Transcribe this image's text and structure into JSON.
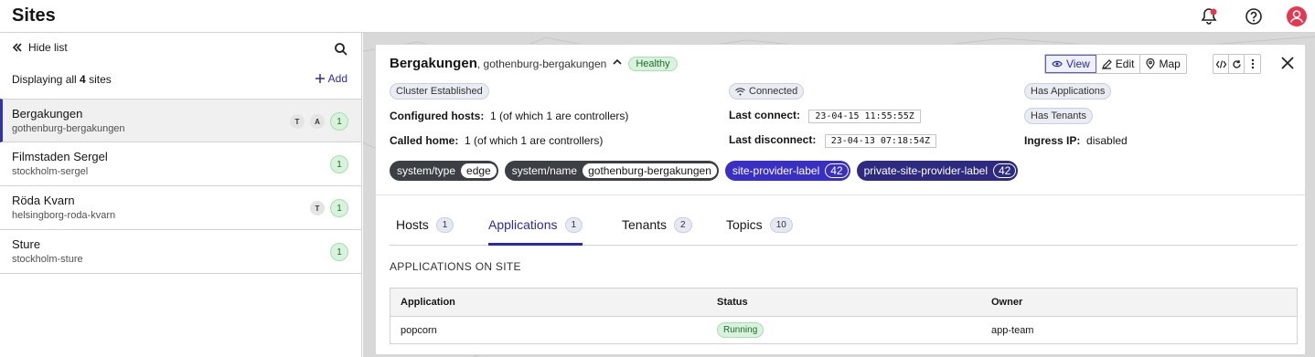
{
  "page": {
    "title": "Sites"
  },
  "sidebar": {
    "hide_list": "Hide list",
    "displaying_prefix": "Displaying all",
    "displaying_count": "4",
    "displaying_suffix": "sites",
    "add_label": "Add",
    "sites": [
      {
        "name": "Bergakungen",
        "slug": "gothenburg-bergakungen",
        "flags": [
          "T",
          "A"
        ],
        "count": "1",
        "selected": true
      },
      {
        "name": "Filmstaden Sergel",
        "slug": "stockholm-sergel",
        "flags": [],
        "count": "1",
        "selected": false
      },
      {
        "name": "Röda Kvarn",
        "slug": "helsingborg-roda-kvarn",
        "flags": [
          "T"
        ],
        "count": "1",
        "selected": false
      },
      {
        "name": "Sture",
        "slug": "stockholm-sture",
        "flags": [],
        "count": "1",
        "selected": false
      }
    ]
  },
  "detail": {
    "name": "Bergakungen",
    "slug": ", gothenburg-bergakungen",
    "health": "Healthy",
    "actions": {
      "view": "View",
      "edit": "Edit",
      "map": "Map"
    },
    "status_pills": {
      "cluster": "Cluster Established",
      "connected": "Connected",
      "has_apps": "Has Applications",
      "has_tenants": "Has Tenants"
    },
    "configured_hosts_label": "Configured hosts:",
    "configured_hosts_value": "1 (of which 1 are controllers)",
    "called_home_label": "Called home:",
    "called_home_value": "1 (of which 1 are controllers)",
    "last_connect_label": "Last connect:",
    "last_connect_value": "23-04-15 11:55:55Z",
    "last_disconnect_label": "Last disconnect:",
    "last_disconnect_value": "23-04-13 07:18:54Z",
    "ingress_label": "Ingress IP:",
    "ingress_value": "disabled",
    "labels": [
      {
        "key": "system/type",
        "value": "edge"
      },
      {
        "key": "system/name",
        "value": "gothenburg-bergakungen"
      },
      {
        "key": "site-provider-label",
        "value": "42"
      },
      {
        "key": "private-site-provider-label",
        "value": "42"
      }
    ]
  },
  "tabs": [
    {
      "label": "Hosts",
      "count": "1"
    },
    {
      "label": "Applications",
      "count": "1"
    },
    {
      "label": "Tenants",
      "count": "2"
    },
    {
      "label": "Topics",
      "count": "10"
    }
  ],
  "applications": {
    "section_title": "APPLICATIONS ON SITE",
    "columns": [
      "Application",
      "Status",
      "Owner"
    ],
    "rows": [
      {
        "application": "popcorn",
        "status": "Running",
        "owner": "app-team"
      }
    ]
  },
  "colors": {
    "accent": "#2b2ba8",
    "healthy": "#1e6b2e",
    "notification": "#e8364f"
  }
}
